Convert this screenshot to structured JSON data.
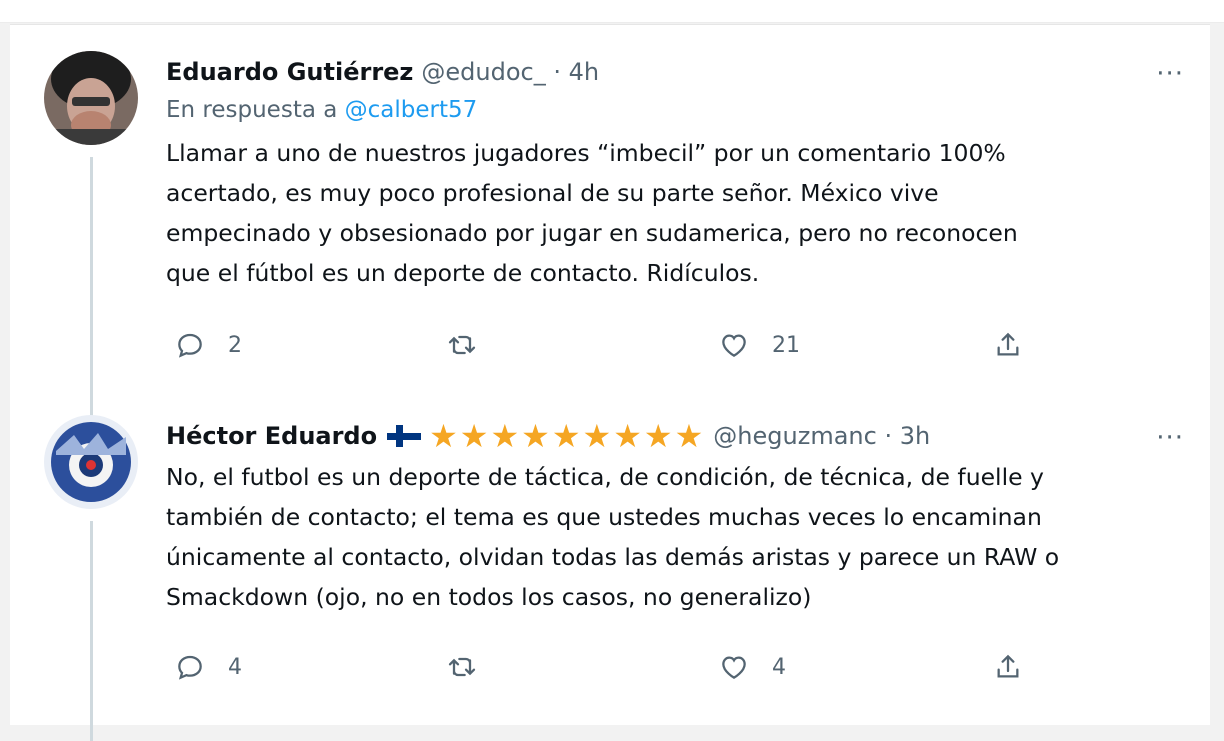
{
  "tweets": [
    {
      "name": "Eduardo Gutiérrez",
      "handle": "@edudoc_ · 4h",
      "reply_prefix": "En respuesta a",
      "reply_mention": "@calbert57",
      "text_lines": [
        "Llamar a uno de nuestros jugadores “imbecil” por un comentario 100%",
        "acertado, es muy poco profesional de su parte señor. México vive",
        "empecinado y obsesionado por jugar en sudamerica, pero no reconocen",
        "que el fútbol es un deporte de contacto. Ridículos."
      ],
      "replies": "2",
      "retweets": "",
      "likes": "21",
      "more": "···"
    },
    {
      "name": "Héctor Eduardo",
      "stars": "★★★★★★★★★",
      "handle": "@heguzmanc · 3h",
      "text_lines": [
        "No, el futbol es un deporte de táctica, de condición, de técnica, de fuelle y",
        "también de contacto; el tema es que ustedes muchas veces lo encaminan",
        "únicamente al contacto, olvidan todas las demás aristas y parece un RAW o",
        "Smackdown (ojo, no en todos los casos, no generalizo)"
      ],
      "replies": "4",
      "retweets": "",
      "likes": "4",
      "more": "···"
    }
  ],
  "icons": [
    "reply-icon",
    "retweet-icon",
    "like-icon",
    "share-icon",
    "more-icon",
    "finland-flag-icon",
    "star-icon"
  ],
  "colors": {
    "link": "#1d9bf0",
    "secondary": "#536471",
    "star": "#f5a623",
    "text": "#0f1419"
  }
}
